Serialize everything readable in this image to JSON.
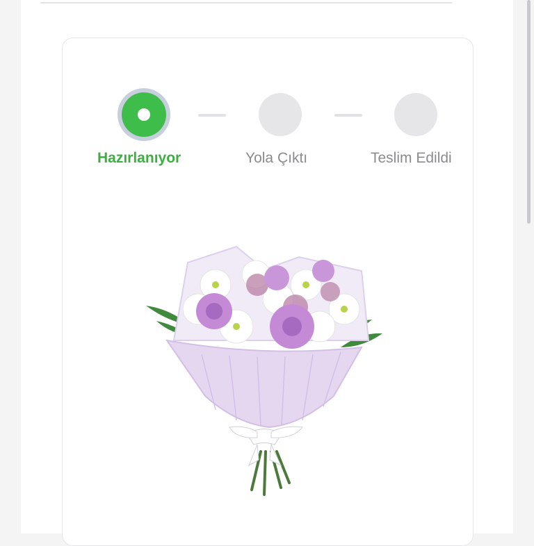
{
  "order_status": {
    "steps": [
      {
        "label": "Hazırlanıyor",
        "state": "active"
      },
      {
        "label": "Yola Çıktı",
        "state": "pending"
      },
      {
        "label": "Teslim Edildi",
        "state": "pending"
      }
    ]
  },
  "product": {
    "image": "flower-bouquet-icon"
  },
  "colors": {
    "active": "#3fbd4a",
    "active_label": "#3fae42",
    "inactive": "#e6e6e8",
    "inactive_label": "#8b8b8e",
    "wrap": "#e6d7f1",
    "rose": "#c48ad6"
  }
}
